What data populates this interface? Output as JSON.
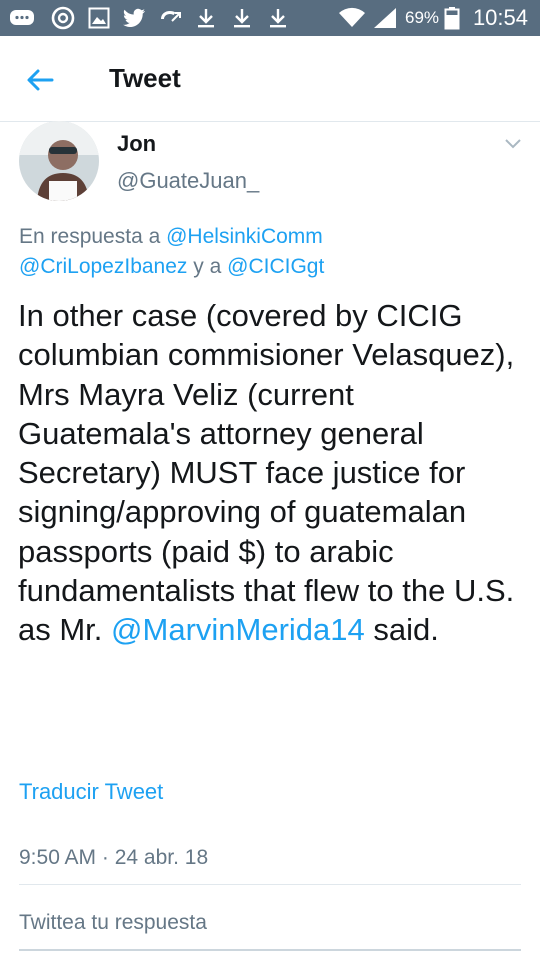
{
  "status_bar": {
    "battery_percent": "69%",
    "time": "10:54",
    "icons": [
      "messages-icon",
      "sync-icon",
      "gallery-icon",
      "twitter-icon",
      "missed-call-icon",
      "download-icon",
      "download-icon",
      "download-icon",
      "wifi-icon",
      "signal-icon",
      "battery-icon"
    ]
  },
  "header": {
    "title": "Tweet",
    "back_icon": "arrow-left-icon"
  },
  "tweet": {
    "author_name": "Jon",
    "author_handle": "@GuateJuan_",
    "reply_prefix": "En respuesta a",
    "reply_mention_1": "@HelsinkiComm",
    "reply_mention_2": "@CriLopezIbanez",
    "reply_joiner": "y a",
    "reply_mention_3": "@CICIGgt",
    "text_main": "In other case (covered by CICIG columbian commisioner Velasquez), Mrs Mayra Veliz (current Guatemala's attorney general Secretary) MUST face justice for signing/approving of guatemalan passports (paid $) to arabic fundamentalists that flew to the U.S. as Mr.",
    "text_mention": "@MarvinMerida14",
    "text_end": "said.",
    "translate_label": "Traducir Tweet",
    "timestamp": "9:50 AM · 24 abr. 18"
  },
  "reply_box": {
    "placeholder": "Twittea tu respuesta"
  },
  "colors": {
    "status_bar": "#586d80",
    "accent": "#1da1f2",
    "muted_text": "#657786",
    "primary_text": "#14171a"
  }
}
